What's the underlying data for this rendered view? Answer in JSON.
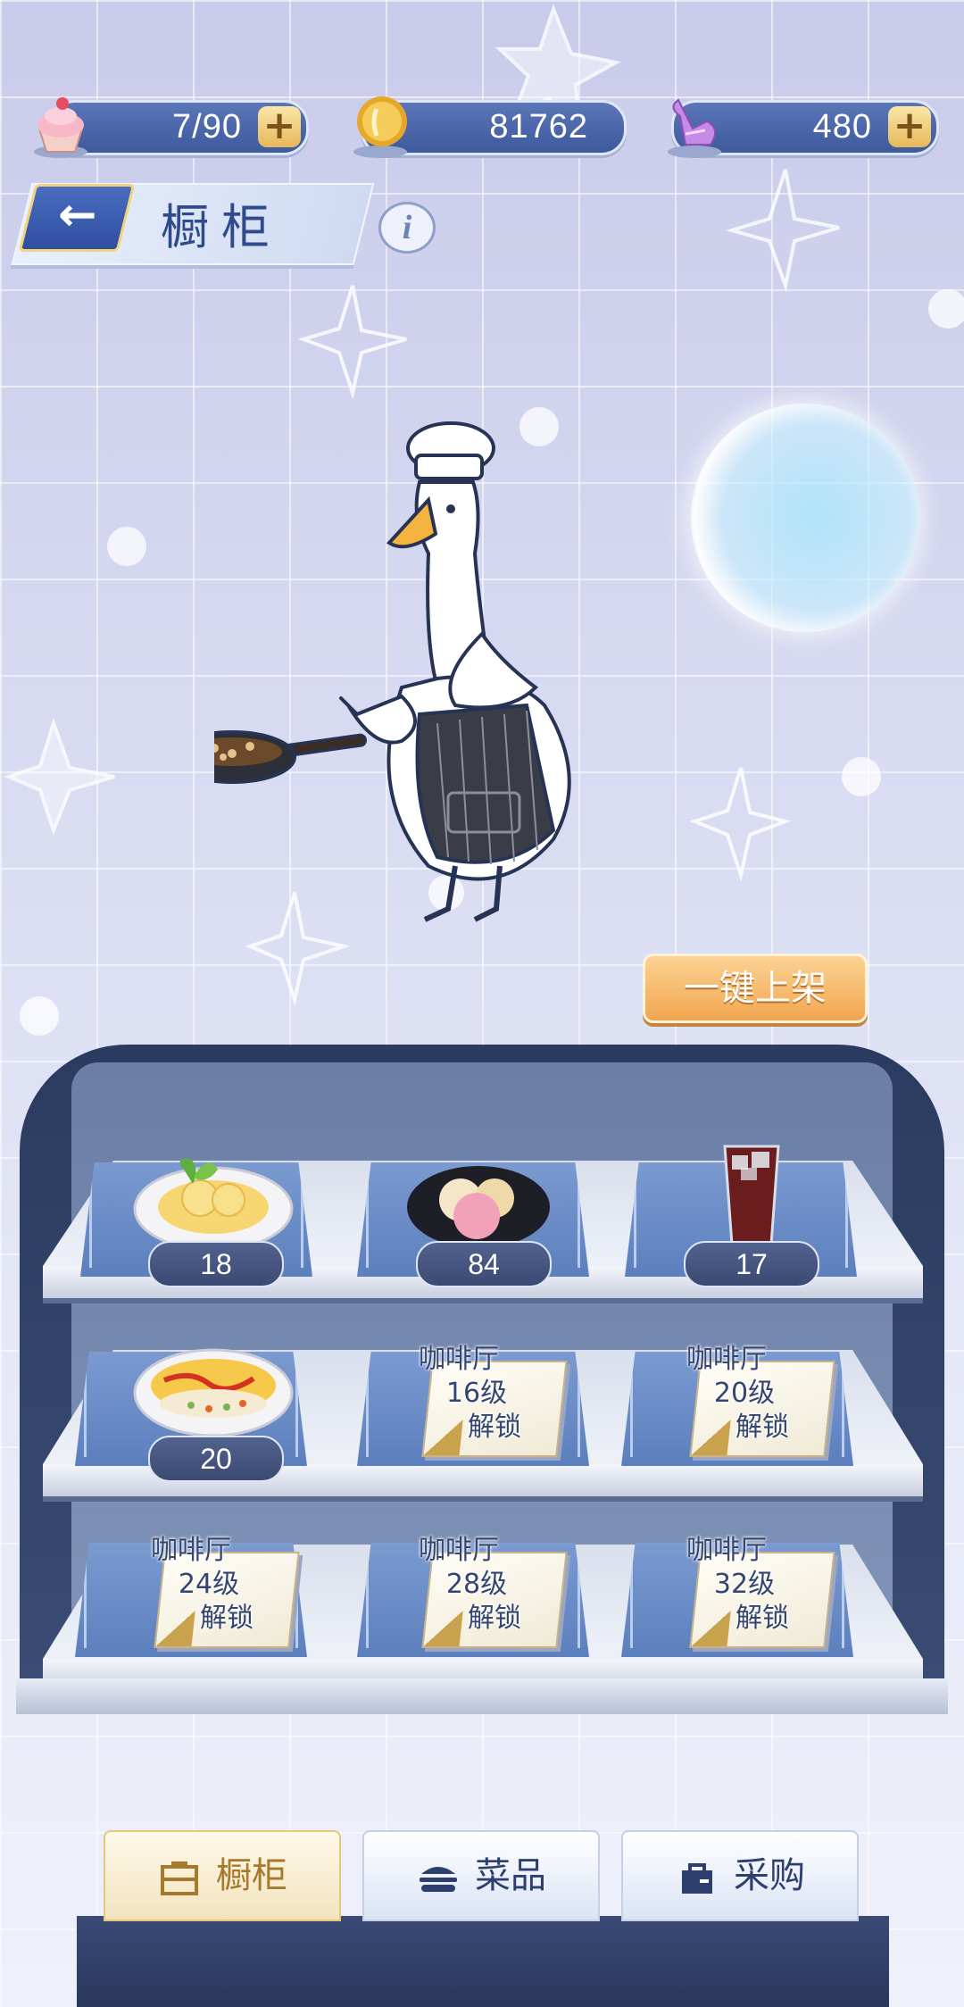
{
  "resources": [
    {
      "icon": "cupcake-icon",
      "value": "7/90",
      "has_plus": true
    },
    {
      "icon": "coin-icon",
      "value": "81762",
      "has_plus": false
    },
    {
      "icon": "crystal-swan-icon",
      "value": "480",
      "has_plus": true
    }
  ],
  "header": {
    "title": "橱柜",
    "back_icon": "back-arrow-icon",
    "info_icon": "info-icon",
    "info_label": "i"
  },
  "one_key_button": "一键上架",
  "shelves": {
    "row1": [
      {
        "icon": "mango-dessert-icon",
        "count": "18"
      },
      {
        "icon": "mochi-plate-icon",
        "count": "84"
      },
      {
        "icon": "iced-cola-icon",
        "count": "17"
      }
    ],
    "row2": [
      {
        "icon": "omelette-rice-icon",
        "count": "20"
      },
      {
        "lock_line1": "咖啡厅",
        "lock_line2": "16级",
        "lock_line3": "解锁"
      },
      {
        "lock_line1": "咖啡厅",
        "lock_line2": "20级",
        "lock_line3": "解锁"
      }
    ],
    "row3": [
      {
        "lock_line1": "咖啡厅",
        "lock_line2": "24级",
        "lock_line3": "解锁"
      },
      {
        "lock_line1": "咖啡厅",
        "lock_line2": "28级",
        "lock_line3": "解锁"
      },
      {
        "lock_line1": "咖啡厅",
        "lock_line2": "32级",
        "lock_line3": "解锁"
      }
    ]
  },
  "tabs": [
    {
      "label": "橱柜",
      "icon": "cabinet-icon",
      "active": true
    },
    {
      "label": "菜品",
      "icon": "burger-icon",
      "active": false
    },
    {
      "label": "采购",
      "icon": "shopping-bag-icon",
      "active": false
    }
  ],
  "colors": {
    "accent_gold": "#e6b85a",
    "nav_blue": "#3d5a9c",
    "button_orange": "#f1a650"
  }
}
